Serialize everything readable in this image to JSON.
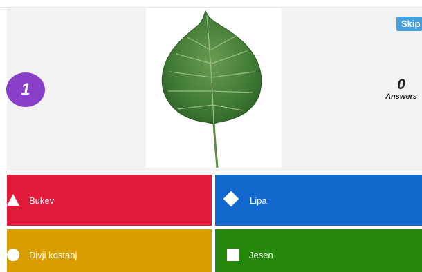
{
  "question": {
    "number": "1",
    "image_subject": "leaf-image"
  },
  "controls": {
    "skip_label": "Skip"
  },
  "answers_counter": {
    "count": "0",
    "label": "Answers"
  },
  "answers": [
    {
      "label": "Bukev",
      "color": "#e21b3c",
      "shape": "triangle-icon"
    },
    {
      "label": "Lipa",
      "color": "#1368ce",
      "shape": "diamond-icon"
    },
    {
      "label": "Divji kostanj",
      "color": "#d89e00",
      "shape": "circle-icon"
    },
    {
      "label": "Jesen",
      "color": "#26890c",
      "shape": "square-icon"
    }
  ],
  "colors": {
    "question_badge": "#8a3fc8",
    "skip_button": "#46a0e0",
    "stage_background": "#f2f2f2"
  }
}
